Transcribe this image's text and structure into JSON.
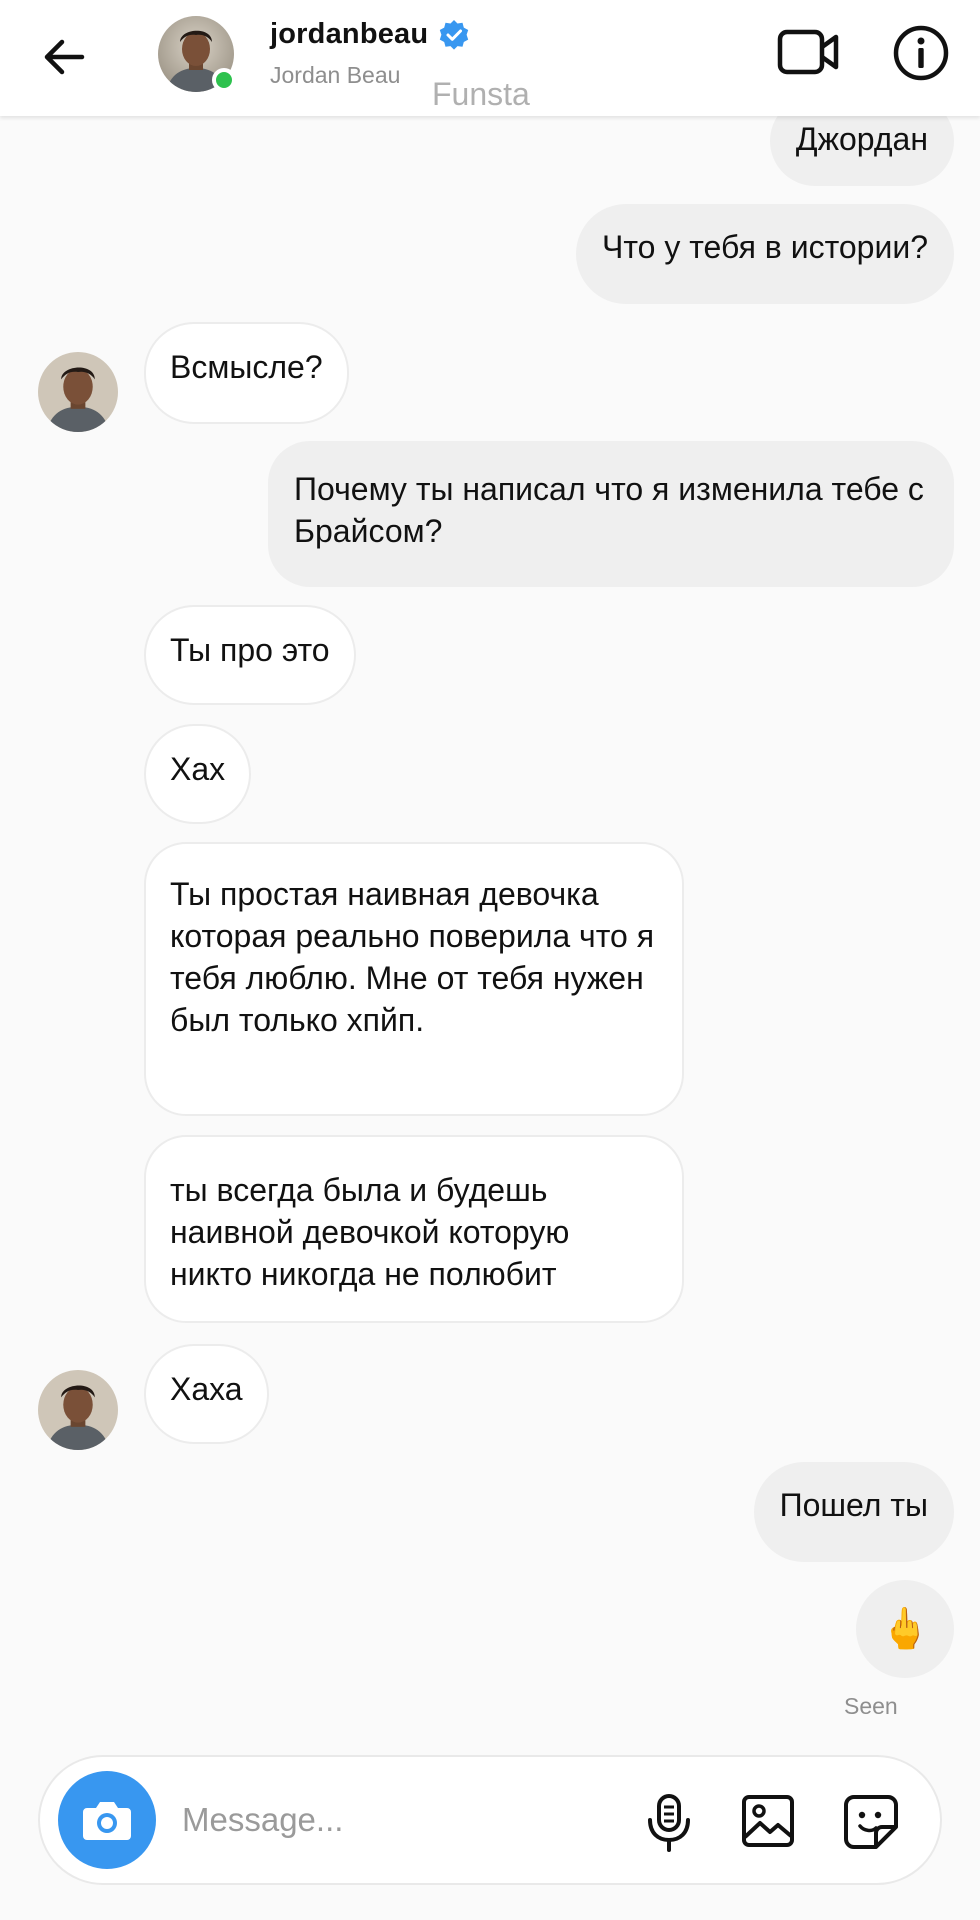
{
  "header": {
    "username": "jordanbeau",
    "full_name": "Jordan Beau",
    "watermark": "Funsta",
    "online": true,
    "verified": true,
    "icons": {
      "back": "back-arrow-icon",
      "video": "video-call-icon",
      "info": "info-icon"
    }
  },
  "messages": [
    {
      "from": "me",
      "text": "Джордан"
    },
    {
      "from": "me",
      "text": "Что у тебя в истории?"
    },
    {
      "from": "them",
      "text": "Всмысле?"
    },
    {
      "from": "me",
      "text": "Почему ты написал что я изменила тебе с Брайсом?"
    },
    {
      "from": "them",
      "text": "Ты про это"
    },
    {
      "from": "them",
      "text": "Хах"
    },
    {
      "from": "them",
      "text": "Ты простая наивная девочка которая реально поверила что я тебя люблю. Мне от тебя нужен был только хпйп."
    },
    {
      "from": "them",
      "text": "ты всегда была и будешь наивной девочкой которую никто никогда не полюбит"
    },
    {
      "from": "them",
      "text": "Хаха"
    },
    {
      "from": "me",
      "text": "Пошел ты"
    },
    {
      "from": "me",
      "text": "🖕"
    }
  ],
  "status": {
    "seen": "Seen"
  },
  "composer": {
    "placeholder": "Message...",
    "icons": {
      "camera": "camera-icon",
      "mic": "microphone-icon",
      "gallery": "gallery-icon",
      "sticker": "sticker-icon"
    }
  },
  "colors": {
    "accent": "#3897f0",
    "online": "#2ec24e",
    "outgoing_bubble": "#efefef",
    "incoming_bubble": "#ffffff",
    "background": "#fafafa"
  }
}
